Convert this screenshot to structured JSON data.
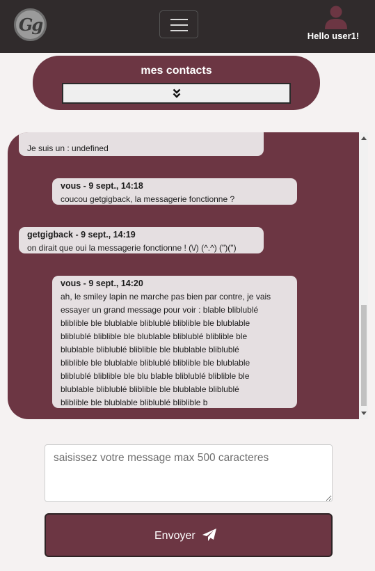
{
  "navbar": {
    "logo_text": "Gg",
    "user_greeting": "Hello user1!"
  },
  "contacts": {
    "title": "mes contacts",
    "selected": ""
  },
  "messages": [
    {
      "sender": "",
      "date": "",
      "text": "Je suis un : undefined"
    },
    {
      "sender": "vous",
      "date": "9 sept., 14:18",
      "text": "coucou getgigback, la messagerie fonctionne ?"
    },
    {
      "sender": "getgigback",
      "date": "9 sept., 14:19",
      "text": "on dirait que oui la messagerie fonctionne ! (\\/) (^.^) (\")(\")"
    },
    {
      "sender": "vous",
      "date": "9 sept., 14:20",
      "text": "ah, le smiley lapin ne marche pas bien par contre, je vais essayer un grand message pour voir : blable bliblublebliblible ble blublable bliblublebliblible ble blublablebliblublebliblible ble blublable bliblublebliblible ble blublable bliblublebliblible ble blublable bliblublebliblible ble blublable bliblublebliblible ble blublable bliblublebliblible ble blu blable bliblible ble blublable bliblublebliblible ble blublable bliblublebliblible ble blublable bliblublebliblible b"
    }
  ],
  "message_lines": [
    "ah, le smiley lapin ne marche pas bien par contre, je vais",
    "essayer un grand message pour voir : blable bliblublé",
    "bliblible ble blublable bliblublé bliblible ble blublable",
    "bliblublé bliblible ble blublable bliblublé bliblible ble",
    "blublable bliblublé bliblible ble blublable bliblublé",
    "bliblible ble blublable bliblublé bliblible ble blublable",
    "bliblublé bliblible ble blu blable bliblublé bliblible ble",
    "blublable bliblublé bliblible ble blublable bliblublé",
    "bliblible ble blublable bliblublé bliblible b"
  ],
  "composer": {
    "placeholder": "saisissez votre message max 500 caracteres",
    "send_label": "Envoyer"
  },
  "colors": {
    "navbar": "#302b2c",
    "accent": "#6c3643",
    "bubble": "#e5dfe1"
  }
}
